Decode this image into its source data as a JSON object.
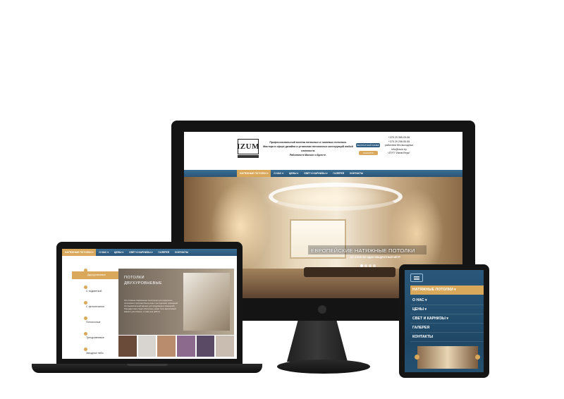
{
  "site": {
    "logo": "IZUM",
    "tagline": [
      "Профессиональный монтаж натяжных и тканевых потолков.",
      "Мастера в сфере дизайна и установки потолочных конструкций любой сложности.",
      "Работаем в Минске и Бресте."
    ],
    "button_dark": "БЕСПЛАТНЫЙ ЗАМЕР",
    "button_gold": "ЗАКАЗАТЬ ЗВОНОК",
    "contacts": [
      "+375 29 385-05-58",
      "+375 29 258-55-55",
      "работаем без выходных",
      "info@izum.by",
      "ЧТУП \"Изюм Втум\""
    ]
  },
  "nav": [
    {
      "label": "НАТЯЖНЫЕ ПОТОЛКИ",
      "arrow": "▾",
      "active": true
    },
    {
      "label": "О НАС",
      "arrow": "▾",
      "active": false
    },
    {
      "label": "ЦЕНЫ",
      "arrow": "▾",
      "active": false
    },
    {
      "label": "СВЕТ И КАРНИЗЫ",
      "arrow": "▾",
      "active": false
    },
    {
      "label": "ГАЛЕРЕЯ",
      "arrow": "",
      "active": false
    },
    {
      "label": "КОНТАКТЫ",
      "arrow": "",
      "active": false
    }
  ],
  "hero": {
    "title": "ЕВРОПЕЙСКИЕ НАТЯЖНЫЕ ПОТОЛКИ",
    "subtitle": "ОТ 4 ЯУБ ВК ОДИН КВАДРАТНЫЙ МЕТР"
  },
  "laptop": {
    "menu": [
      "Двухуровневые",
      "С подсветкой",
      "С фотопечатью",
      "Потолочные",
      "Трехуровневые",
      "Звездное небо"
    ],
    "content_title": [
      "ПОТОЛКИ",
      "ДВУХУРОВНЕВЫЕ"
    ],
    "content_text": "Это сложные современные конструкции для разделения потолочного пространства на зоны и на отделение помещений. Это выразительный вариант для продуманных помещений, благодаря свету будет обустроено, может быть вариативный вариант для спальни, а также для работы.",
    "thumb_colors": [
      "#6a4b3a",
      "#d8d4cf",
      "#b98c6e",
      "#8c6a8e",
      "#5a4a66",
      "#c9bdb2"
    ]
  },
  "tablet": {
    "menu": [
      {
        "label": "НАТЯЖНЫЕ ПОТОЛКИ ▾",
        "active": true
      },
      {
        "label": "О НАС ▾",
        "active": false
      },
      {
        "label": "ЦЕНЫ ▾",
        "active": false
      },
      {
        "label": "СВЕТ И КАРНИЗЫ ▾",
        "active": false
      },
      {
        "label": "ГАЛЕРЕЯ",
        "active": false
      },
      {
        "label": "КОНТАКТЫ",
        "active": false
      }
    ]
  },
  "icons": [
    "menu-icon",
    "apple-icon"
  ],
  "colors": {
    "accent": "#d9a85a",
    "nav": "#2f5e82",
    "bezel": "#151515"
  }
}
